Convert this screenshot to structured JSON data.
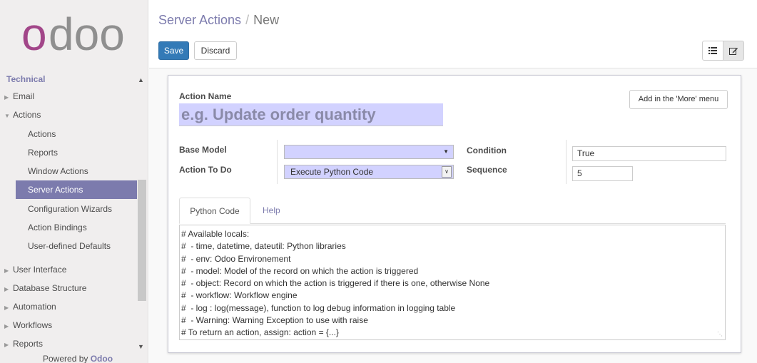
{
  "sidebar": {
    "logo_text": "odoo",
    "menu_title": "Technical",
    "items": [
      {
        "label": "Email",
        "type": "collapsed"
      },
      {
        "label": "Actions",
        "type": "expanded"
      },
      {
        "label": "Actions",
        "type": "sub"
      },
      {
        "label": "Reports",
        "type": "sub"
      },
      {
        "label": "Window Actions",
        "type": "sub"
      },
      {
        "label": "Server Actions",
        "type": "sub",
        "active": true
      },
      {
        "label": "Configuration Wizards",
        "type": "sub"
      },
      {
        "label": "Action Bindings",
        "type": "sub"
      },
      {
        "label": "User-defined Defaults",
        "type": "sub"
      },
      {
        "label": "User Interface",
        "type": "collapsed"
      },
      {
        "label": "Database Structure",
        "type": "collapsed"
      },
      {
        "label": "Automation",
        "type": "collapsed"
      },
      {
        "label": "Workflows",
        "type": "collapsed"
      },
      {
        "label": "Reports",
        "type": "collapsed"
      }
    ],
    "powered_prefix": "Powered by",
    "powered_brand": "Odoo"
  },
  "breadcrumb": {
    "parent": "Server Actions",
    "separator": "/",
    "current": "New"
  },
  "toolbar": {
    "save_label": "Save",
    "discard_label": "Discard",
    "list_view_icon": "list-icon",
    "form_view_icon": "edit-icon"
  },
  "form": {
    "action_name_label": "Action Name",
    "action_name_placeholder": "e.g. Update order quantity",
    "more_menu_button": "Add in the 'More' menu",
    "base_model_label": "Base Model",
    "base_model_value": "",
    "action_to_do_label": "Action To Do",
    "action_to_do_value": "Execute Python Code",
    "condition_label": "Condition",
    "condition_value": "True",
    "sequence_label": "Sequence",
    "sequence_value": "5"
  },
  "tabs": {
    "python_code": "Python Code",
    "help": "Help"
  },
  "code_lines": [
    "# Available locals:",
    "#  - time, datetime, dateutil: Python libraries",
    "#  - env: Odoo Environement",
    "#  - model: Model of the record on which the action is triggered",
    "#  - object: Record on which the action is triggered if there is one, otherwise None",
    "#  - workflow: Workflow engine",
    "#  - log : log(message), function to log debug information in logging table",
    "#  - Warning: Warning Exception to use with raise",
    "# To return an action, assign: action = {...}"
  ],
  "colors": {
    "brand": "#7c7bad",
    "primary_button": "#337ab7",
    "required_field": "#d2d2ff"
  }
}
